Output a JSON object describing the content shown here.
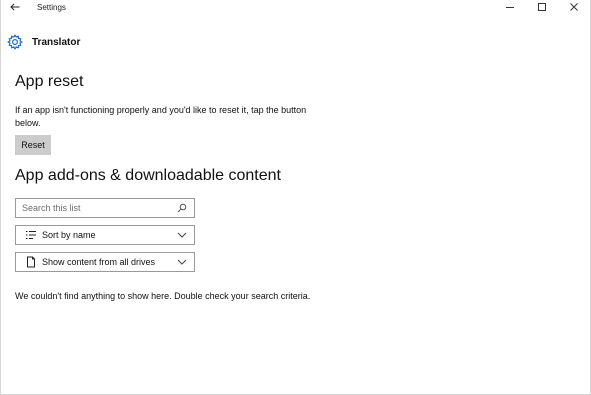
{
  "titlebar": {
    "title": "Settings",
    "back_icon": "back-arrow-icon",
    "minimize_icon": "minimize-icon",
    "maximize_icon": "maximize-icon",
    "close_icon": "close-icon"
  },
  "header": {
    "icon": "gear-icon",
    "app_name": "Translator"
  },
  "reset": {
    "heading": "App reset",
    "description": "If an app isn't functioning properly and you'd like to reset it, tap the button below.",
    "button_label": "Reset"
  },
  "addons": {
    "heading": "App add-ons & downloadable content",
    "search_placeholder": "Search this list",
    "search_icon": "search-icon",
    "sort": {
      "icon": "list-sort-icon",
      "selected": "Sort by name"
    },
    "filter": {
      "icon": "drive-icon",
      "selected": "Show content from all drives"
    },
    "empty_message": "We couldn't find anything to show here. Double check your search criteria."
  },
  "colors": {
    "accent": "#1a6fc4",
    "button_bg": "#cccccc",
    "field_border": "#9a9a9a"
  }
}
